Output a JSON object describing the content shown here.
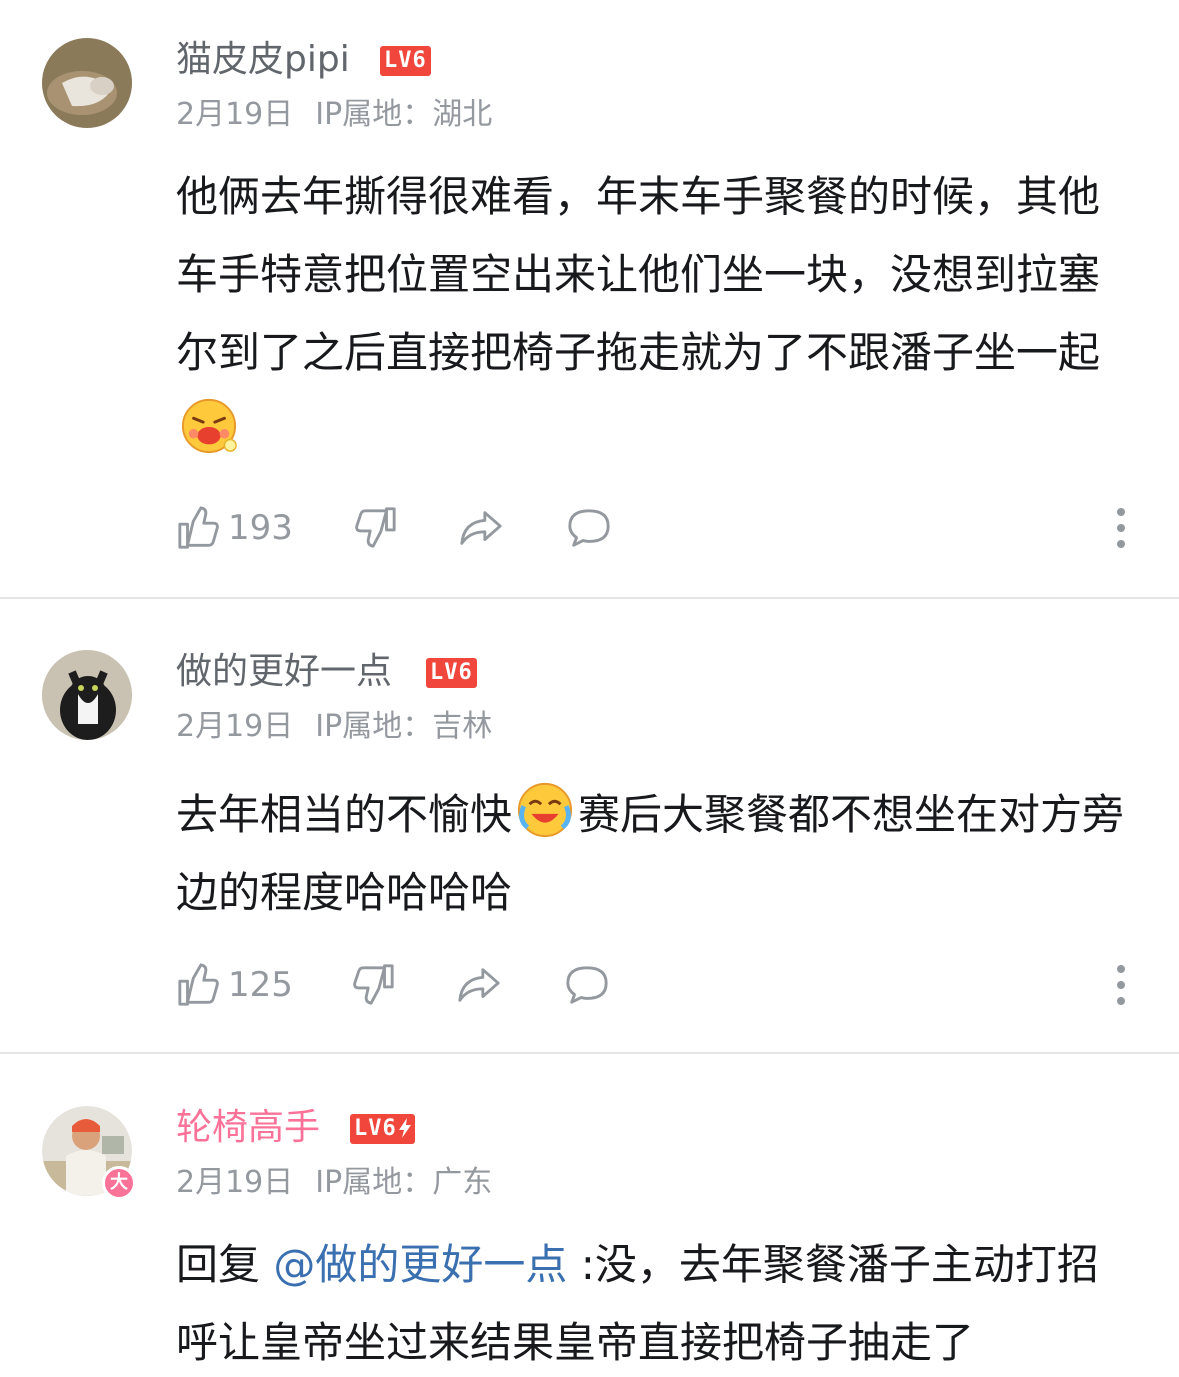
{
  "comments": [
    {
      "username": "猫皮皮pipi",
      "level": "LV6",
      "date": "2月19日",
      "ip_label": "IP属地：湖北",
      "text": "他俩去年撕得很难看，年末车手聚餐的时候，其他车手特意把位置空出来让他们坐一块，没想到拉塞尔到了之后直接把椅子拖走就为了不跟潘子坐一起",
      "likes": "193"
    },
    {
      "username": "做的更好一点",
      "level": "LV6",
      "date": "2月19日",
      "ip_label": "IP属地：吉林",
      "text_before_emoji": "去年相当的不愉快",
      "text_after_emoji": "赛后大聚餐都不想坐在对方旁边的程度哈哈哈哈",
      "likes": "125"
    },
    {
      "username": "轮椅高手",
      "level": "LV6",
      "avatar_badge": "大",
      "date": "2月19日",
      "ip_label": "IP属地：广东",
      "reply_prefix": "回复",
      "mention": "@做的更好一点",
      "text": ":没，去年聚餐潘子主动打招呼让皇帝坐过来结果皇帝直接把椅子抽走了"
    }
  ],
  "icons": {
    "like": "thumbs-up-icon",
    "dislike": "thumbs-down-icon",
    "share": "share-icon",
    "reply": "comment-icon",
    "more": "more-vertical-icon"
  },
  "colors": {
    "username": "#61666d",
    "vip_username": "#fb7299",
    "level_badge": "#f0463c",
    "meta": "#9499a0",
    "mention": "#3a6fb0"
  }
}
